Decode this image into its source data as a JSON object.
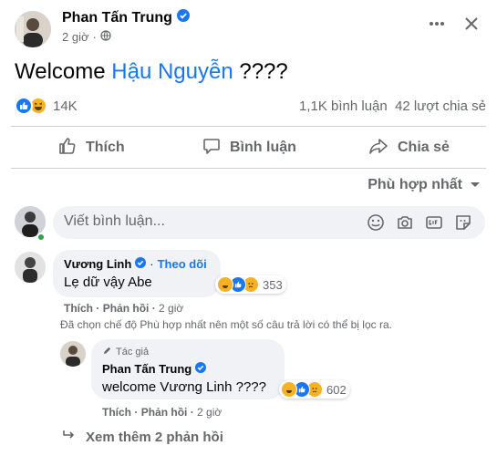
{
  "post": {
    "author": "Phan Tấn Trung",
    "time": "2 giờ",
    "text_prefix": "Welcome ",
    "mention": "Hậu Nguyễn",
    "text_suffix": " ????",
    "reaction_icons": [
      "haha",
      "like",
      "wow"
    ],
    "reaction_count": "14K",
    "comment_count": "1,1K bình luận",
    "share_count": "42 lượt chia sẻ"
  },
  "actions": {
    "like": "Thích",
    "comment": "Bình luận",
    "share": "Chia sẻ"
  },
  "sort": {
    "label": "Phù hợp nhất"
  },
  "composer": {
    "placeholder": "Viết bình luận..."
  },
  "comments": [
    {
      "author": "Vương Linh",
      "follow": "Theo dõi",
      "text": "Lẹ dữ vậy Abe",
      "reaction_count": "353",
      "like": "Thích",
      "reply": "Phản hồi",
      "time": "2 giờ"
    }
  ],
  "filter_note": "Đã chọn chế độ Phù hợp nhất nên một số câu trả lời có thể bị lọc ra.",
  "reply": {
    "author_tag": "Tác giả",
    "author": "Phan Tấn Trung",
    "text": "welcome Vương Linh ????",
    "reaction_count": "602",
    "like": "Thích",
    "reply": "Phản hồi",
    "time": "2 giờ"
  },
  "more_replies": "Xem thêm 2 phản hồi",
  "colors": {
    "accent": "#1877f2",
    "muted": "#65676b",
    "bubble": "#f0f2f5"
  }
}
